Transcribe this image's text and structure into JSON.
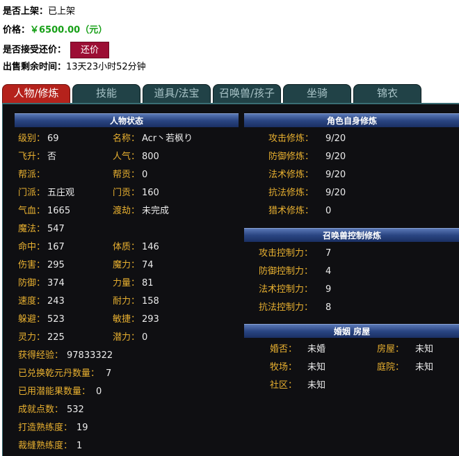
{
  "listing": {
    "shelf_label": "是否上架：",
    "shelf_value": "已上架",
    "price_label": "价格：",
    "price_value": "￥6500.00（元）",
    "bargain_label": "是否接受还价：",
    "bargain_button": "还价",
    "remaining_label": "出售剩余时间：",
    "remaining_value": "13天23小时52分钟"
  },
  "tabs": [
    {
      "label": "人物/修炼",
      "active": true
    },
    {
      "label": "技能"
    },
    {
      "label": "道具/法宝"
    },
    {
      "label": "召唤兽/孩子"
    },
    {
      "label": "坐骑"
    },
    {
      "label": "锦衣"
    }
  ],
  "character": {
    "title": "人物状态",
    "level_label": "级别：",
    "level": "69",
    "name_label": "名称：",
    "name": "Acr丶若枫り",
    "fly_label": "飞升：",
    "fly": "否",
    "pop_label": "人气：",
    "pop": "800",
    "gang_label": "帮派：",
    "gang": "",
    "gang_contrib_label": "帮贡：",
    "gang_contrib": "0",
    "school_label": "门派：",
    "school": "五庄观",
    "school_contrib_label": "门贡：",
    "school_contrib": "160",
    "hp_label": "气血：",
    "hp": "1665",
    "tribulation_label": "渡劫：",
    "tribulation": "未完成",
    "mp_label": "魔法：",
    "mp": "547",
    "hit_label": "命中：",
    "hit": "167",
    "con_label": "体质：",
    "con": "146",
    "dmg_label": "伤害：",
    "dmg": "295",
    "magic_label": "魔力：",
    "magic": "74",
    "def_label": "防御：",
    "def": "374",
    "str_label": "力量：",
    "str": "81",
    "spd_label": "速度：",
    "spd": "243",
    "end_label": "耐力：",
    "end": "158",
    "dodge_label": "躲避：",
    "dodge": "523",
    "agi_label": "敏捷：",
    "agi": "293",
    "spirit_label": "灵力：",
    "spirit": "225",
    "potential_label": "潜力：",
    "potential": "0",
    "exp_label": "获得经验：",
    "exp": "97833322",
    "qianyuan_label": "已兑换乾元丹数量：",
    "qianyuan": "7",
    "fruit_label": "已用潜能果数量：",
    "fruit": "0",
    "achieve_label": "成就点数：",
    "achieve": "532",
    "forge_label": "打造熟练度：",
    "forge": "19",
    "tailor_label": "裁缝熟练度：",
    "tailor": "1"
  },
  "self_cultivation": {
    "title": "角色自身修炼",
    "items": [
      {
        "label": "攻击修炼：",
        "value": "9/20"
      },
      {
        "label": "防御修炼：",
        "value": "9/20"
      },
      {
        "label": "法术修炼：",
        "value": "9/20"
      },
      {
        "label": "抗法修炼：",
        "value": "9/20"
      },
      {
        "label": "猎术修炼：",
        "value": "0"
      }
    ]
  },
  "pet_control": {
    "title": "召唤兽控制修炼",
    "items": [
      {
        "label": "攻击控制力：",
        "value": "7"
      },
      {
        "label": "防御控制力：",
        "value": "4"
      },
      {
        "label": "法术控制力：",
        "value": "9"
      },
      {
        "label": "抗法控制力：",
        "value": "8"
      }
    ]
  },
  "home": {
    "title": "婚姻 房屋",
    "marriage_label": "婚否：",
    "marriage": "未婚",
    "house_label": "房屋：",
    "house": "未知",
    "ranch_label": "牧场：",
    "ranch": "未知",
    "courtyard_label": "庭院：",
    "courtyard": "未知",
    "community_label": "社区：",
    "community": "未知"
  },
  "colors": {
    "tab_active": "#b5221c",
    "tab_inactive": "#214247",
    "panel_bg": "#0f0f12",
    "label": "#e8b030",
    "value": "#ececec",
    "price": "#18a018",
    "bargain_button": "#9c0e34"
  }
}
